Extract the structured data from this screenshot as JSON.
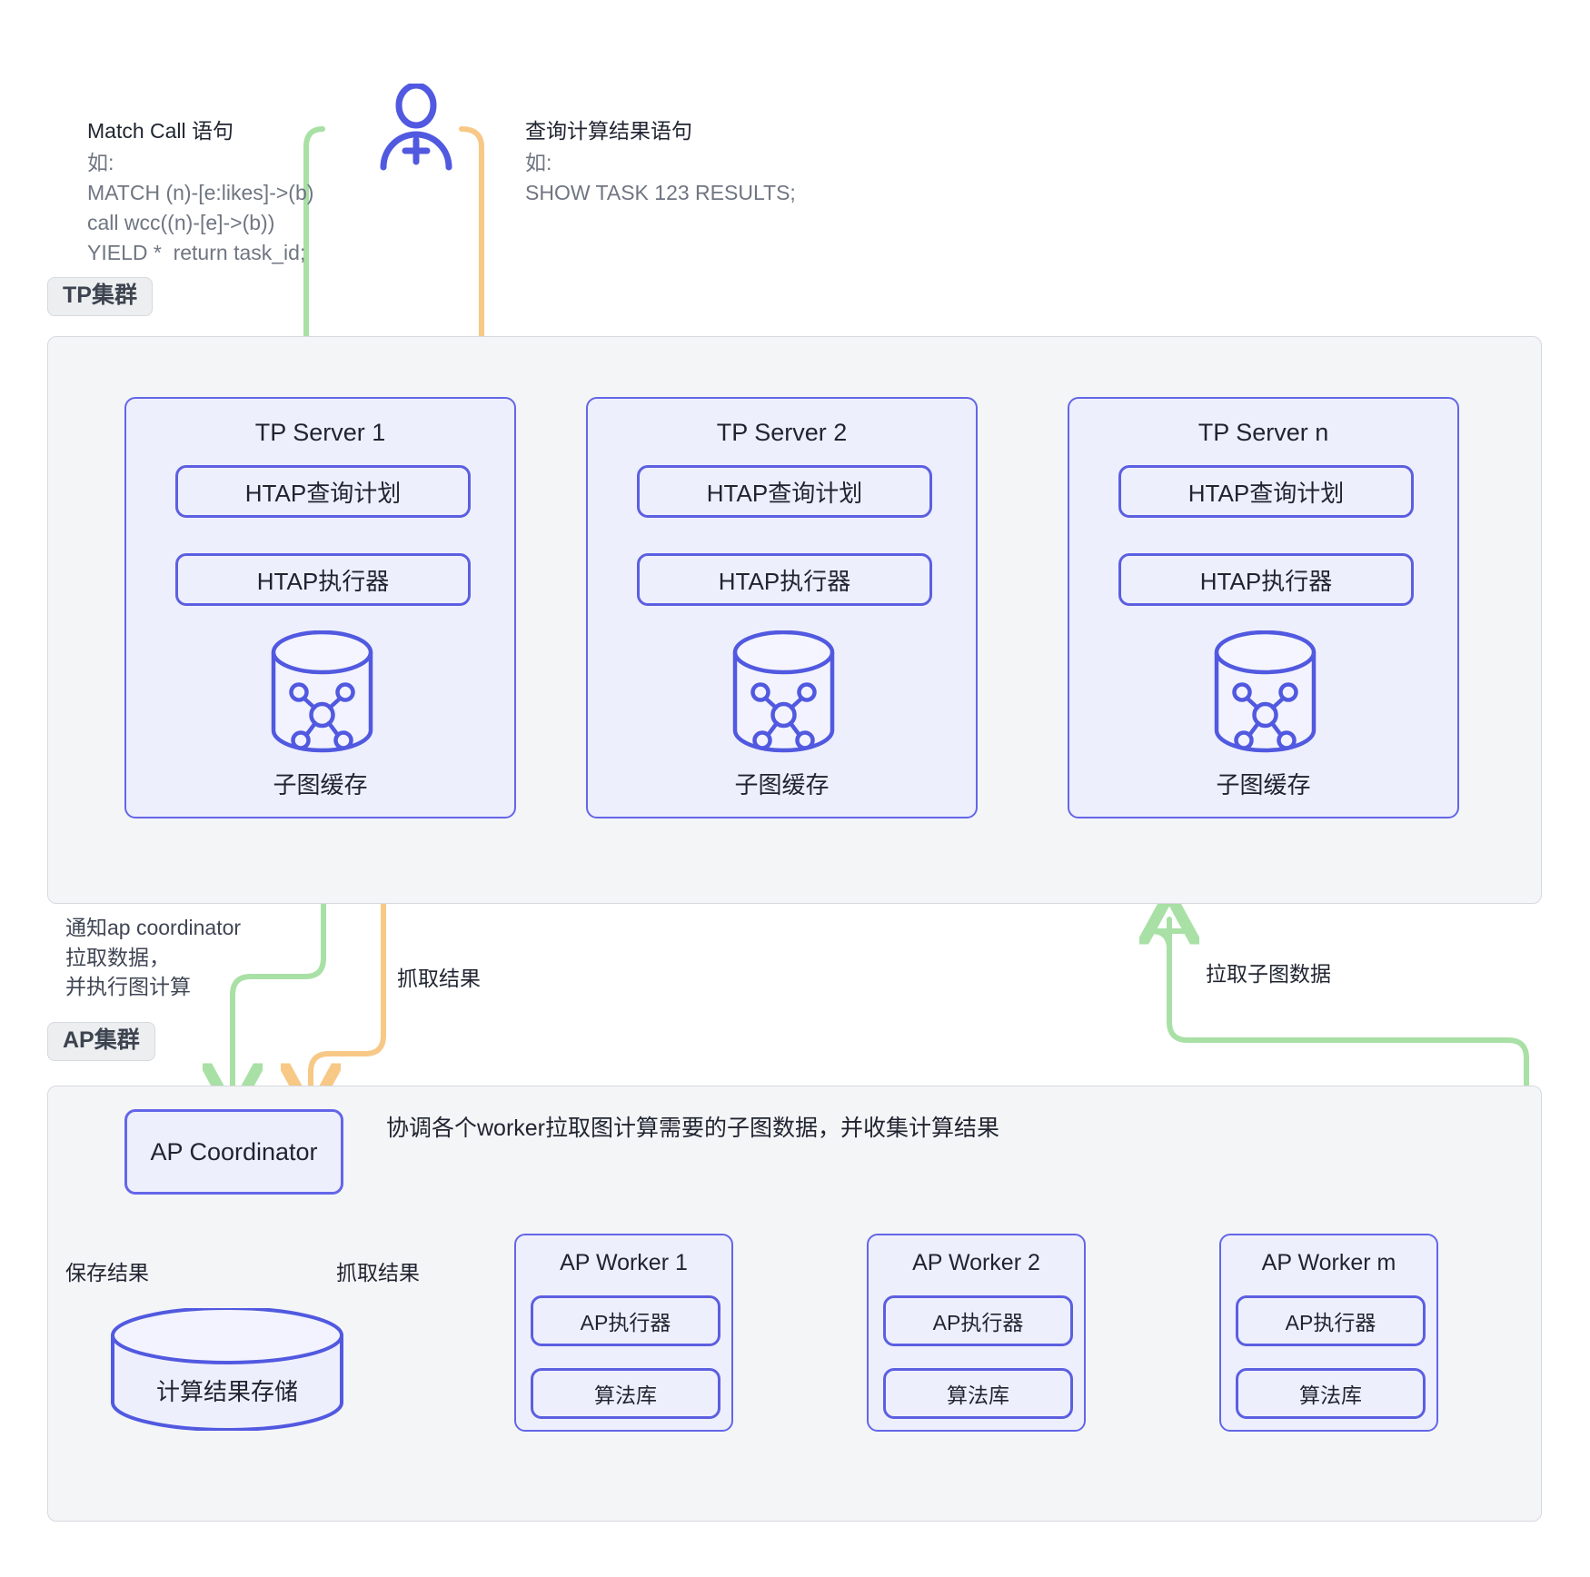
{
  "diagram": {
    "title": "HTAP graph database TP/AP cluster architecture",
    "colors": {
      "node_border": "#6366e8",
      "node_fill": "#eeeffd",
      "cluster_fill": "#f4f5f7",
      "cluster_border": "#d6d9de",
      "flow_green": "#a9e0a5",
      "flow_orange": "#f7c886",
      "arrow_black": "#111111",
      "text": "#1f2430"
    },
    "actor": {
      "icon": "user-plus-icon"
    },
    "left_statement": {
      "title": "Match Call 语句",
      "prefix": "如:",
      "lines": [
        "MATCH (n)-[e:likes]->(b)",
        "call wcc((n)-[e]->(b))",
        "YIELD *  return task_id;"
      ]
    },
    "right_statement": {
      "title": "查询计算结果语句",
      "prefix": "如:",
      "lines": [
        "SHOW TASK 123 RESULTS;"
      ]
    },
    "tp_cluster": {
      "tag": "TP集群",
      "servers": [
        {
          "name": "TP Server 1",
          "plan": "HTAP查询计划",
          "executor": "HTAP执行器",
          "cache_label": "子图缓存",
          "cache_icon": "graph-database-cylinder-icon"
        },
        {
          "name": "TP Server 2",
          "plan": "HTAP查询计划",
          "executor": "HTAP执行器",
          "cache_label": "子图缓存",
          "cache_icon": "graph-database-cylinder-icon"
        },
        {
          "name": "TP Server n",
          "plan": "HTAP查询计划",
          "executor": "HTAP执行器",
          "cache_label": "子图缓存",
          "cache_icon": "graph-database-cylinder-icon"
        }
      ]
    },
    "ap_cluster": {
      "tag": "AP集群",
      "coordinator": {
        "name": "AP Coordinator"
      },
      "coordinator_note": "协调各个worker拉取图计算需要的子图数据，并收集计算结果",
      "result_store": {
        "label": "计算结果存储",
        "icon": "database-cylinder-icon"
      },
      "workers": [
        {
          "name": "AP Worker 1",
          "executor": "AP执行器",
          "library": "算法库"
        },
        {
          "name": "AP Worker 2",
          "executor": "AP执行器",
          "library": "算法库"
        },
        {
          "name": "AP Worker m",
          "executor": "AP执行器",
          "library": "算法库"
        }
      ]
    },
    "flow_labels": {
      "notify_coordinator": "通知ap coordinator\n拉取数据，\n并执行图计算",
      "fetch_results_tp": "抓取结果",
      "pull_subgraph": "拉取子图数据",
      "save_results": "保存结果",
      "fetch_results_ap": "抓取结果"
    }
  }
}
